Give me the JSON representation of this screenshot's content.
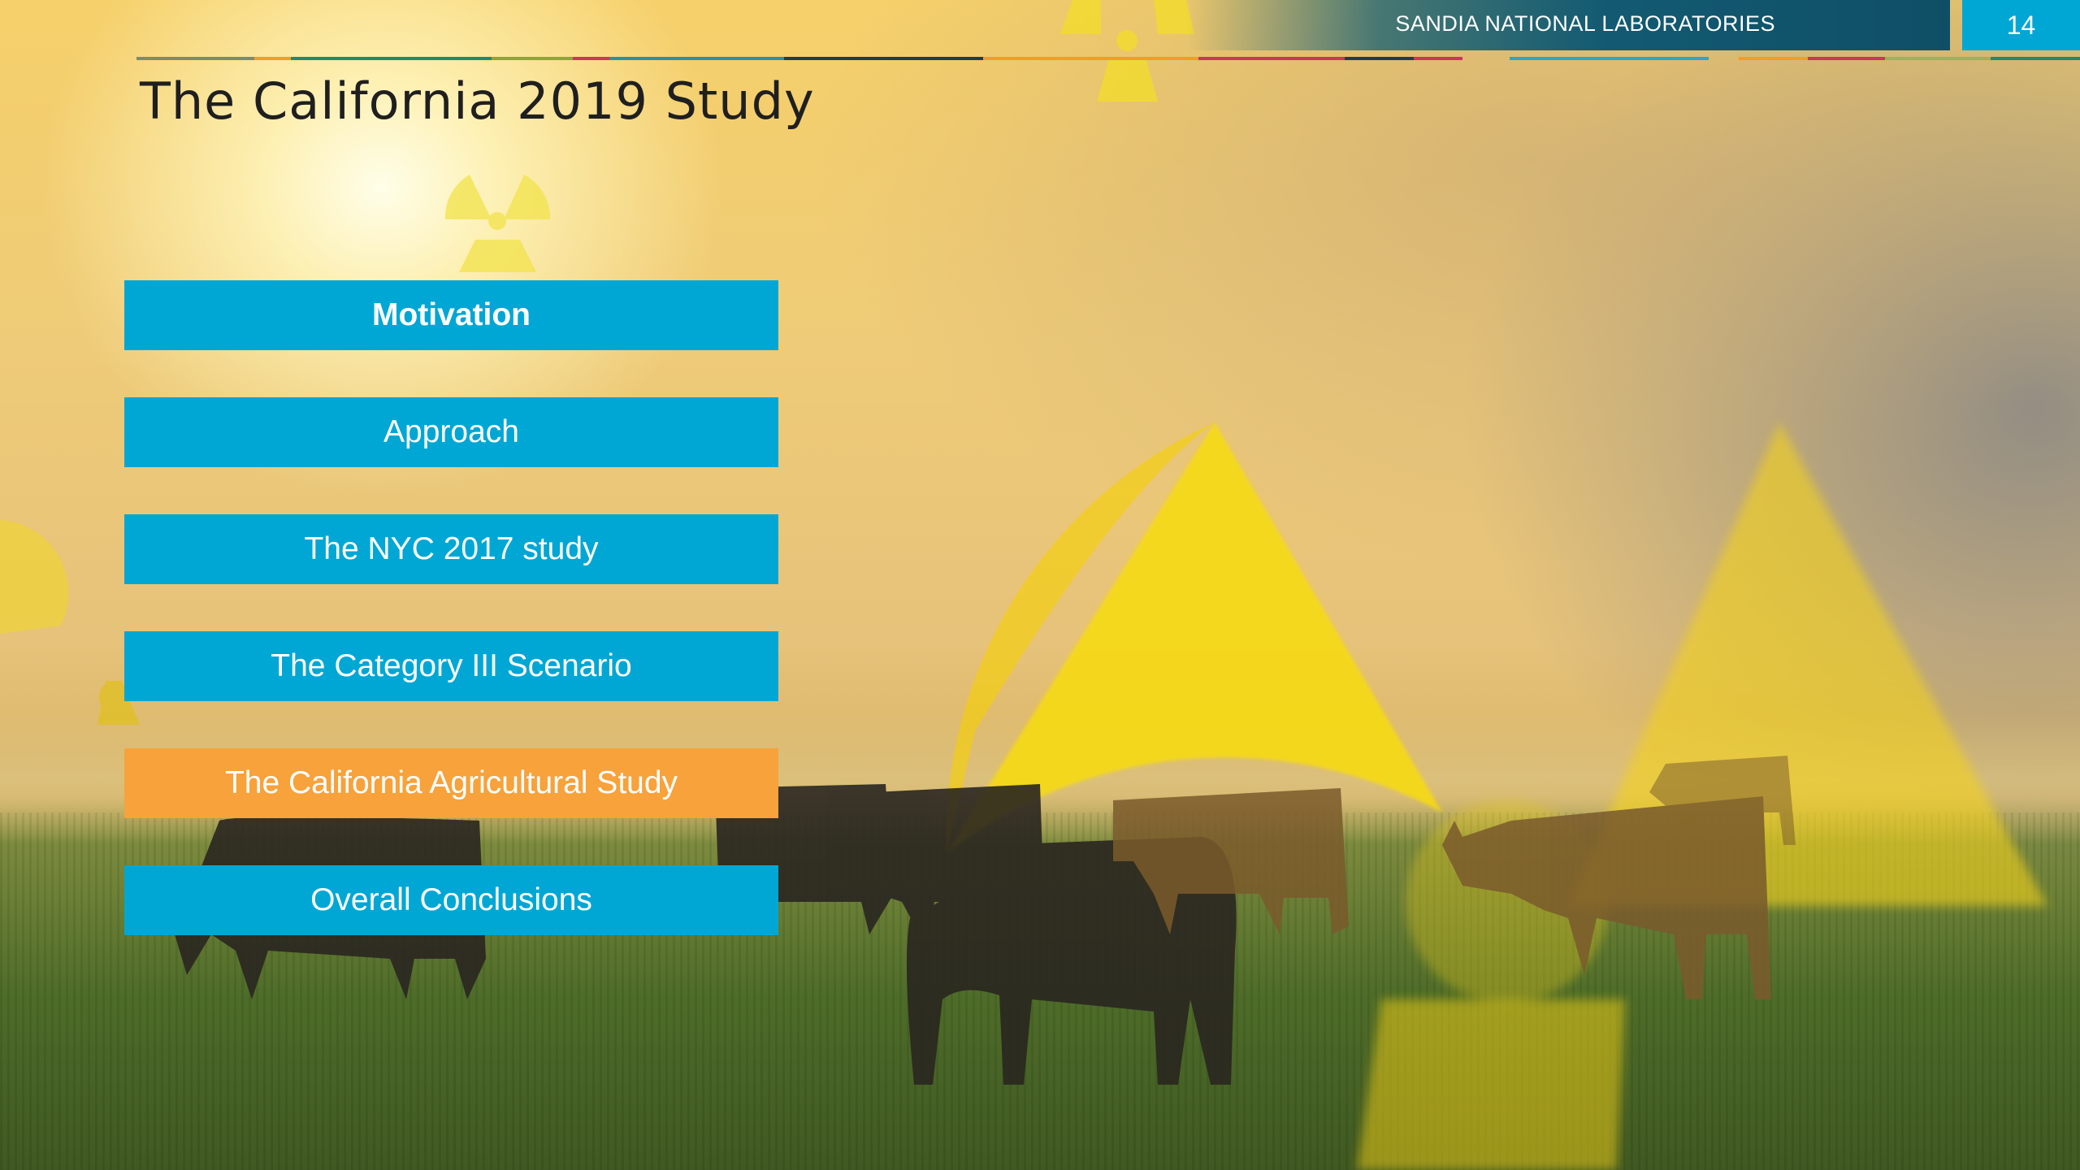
{
  "header": {
    "org_name": "SANDIA NATIONAL LABORATORIES",
    "page_number": "14"
  },
  "slide": {
    "title": "The California 2019 Study"
  },
  "menu": {
    "items": [
      {
        "label": "Motivation",
        "state": "bold"
      },
      {
        "label": "Approach",
        "state": "normal"
      },
      {
        "label": "The NYC 2017 study",
        "state": "normal"
      },
      {
        "label": "The Category III Scenario",
        "state": "normal"
      },
      {
        "label": "The California Agricultural Study",
        "state": "active"
      },
      {
        "label": "Overall Conclusions",
        "state": "normal"
      }
    ]
  },
  "colors": {
    "menu_default": "#00a7d4",
    "menu_active": "#f7a23b",
    "header_bar": "#125a72",
    "page_box": "#00a7d4"
  },
  "background": {
    "icons": [
      "radiation-trefoil-icon",
      "cow-herd-image"
    ]
  }
}
